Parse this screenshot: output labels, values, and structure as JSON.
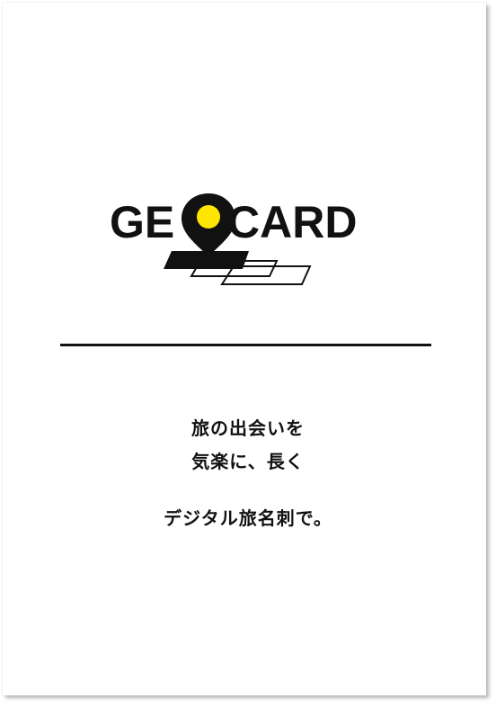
{
  "brand": {
    "name_left": "GE",
    "name_right": "CARD",
    "pin_icon": "map-pin-icon",
    "pin_color": "#ffe600",
    "ink_color": "#111111"
  },
  "tagline": {
    "line1": "旅の出会いを",
    "line2": "気楽に、長く",
    "line3": "デジタル旅名刺で。"
  }
}
